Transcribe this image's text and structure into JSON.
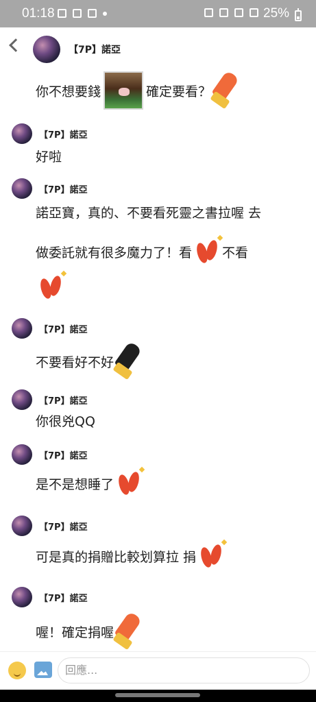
{
  "statusbar": {
    "time": "01:18",
    "battery": "25%"
  },
  "header": {
    "title": "【7P】諾亞",
    "back_icon": "chevron-left-icon",
    "avatar_icon": "galaxy-avatar"
  },
  "messages": [
    {
      "name": "",
      "text": "你不想要錢",
      "text2": "確定要看？"
    },
    {
      "name": "【7P】諾亞",
      "text": "好啦"
    },
    {
      "name": "【7P】諾亞",
      "line1": "諾亞寶，真的、不要看死靈之書拉喔 去",
      "line2a": "做委託就有很多魔力了！看",
      "line2b": "不看"
    },
    {
      "name": "【7P】諾亞",
      "text": "不要看好不好"
    },
    {
      "name": "【7P】諾亞",
      "text": "你很兇QQ"
    },
    {
      "name": "【7P】諾亞",
      "text": "是不是想睡了"
    },
    {
      "name": "【7P】諾亞",
      "text": "可是真的捐贈比較划算拉 捐"
    },
    {
      "name": "【7P】諾亞",
      "text": "喔！確定捐喔"
    }
  ],
  "composer": {
    "placeholder": "回應..."
  },
  "colors": {
    "statusbar": "#a7a7a7",
    "accent_red": "#e64a2e"
  }
}
